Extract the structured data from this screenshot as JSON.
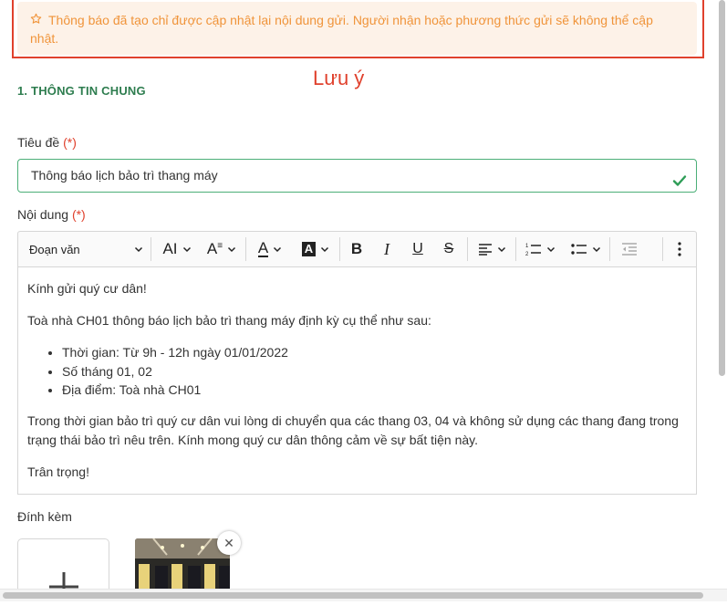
{
  "notice": {
    "text": "Thông báo đã tạo chỉ được cập nhật lại nội dung gửi. Người nhận hoặc phương thức gửi sẽ không thể cập nhật.",
    "annotation": "Lưu ý",
    "icon": "star-outline-icon"
  },
  "section": {
    "title": "1. THÔNG TIN CHUNG"
  },
  "title_field": {
    "label": "Tiêu đề",
    "required": "(*)",
    "value": "Thông báo lịch bảo trì thang máy",
    "status_icon": "check-icon",
    "valid_color": "#2e9d57"
  },
  "content_field": {
    "label": "Nội dung",
    "required": "(*)"
  },
  "toolbar": {
    "paragraph_select": "Đoạn văn",
    "font_size": "AI",
    "font_family": "A",
    "font_color": "A",
    "highlight": "A",
    "bold": "B",
    "italic": "I",
    "underline": "U",
    "strikethrough": "S"
  },
  "editor": {
    "greeting": "Kính gửi quý cư dân!",
    "intro": "Toà nhà CH01 thông báo lịch bảo trì thang máy định kỳ cụ thể như sau:",
    "items": [
      "Thời gian: Từ 9h - 12h ngày 01/01/2022",
      "Số tháng 01, 02",
      "Địa điểm: Toà nhà CH01"
    ],
    "body": "Trong thời gian bảo trì quý cư dân vui lòng di chuyển qua các thang 03, 04 và không sử dụng các thang đang trong trạng thái bảo trì nêu trên. Kính mong quý cư dân thông cảm về sự bất tiện này.",
    "closing": "Trân trọng!"
  },
  "attachments": {
    "label": "Đính kèm",
    "close_symbol": "✕"
  }
}
